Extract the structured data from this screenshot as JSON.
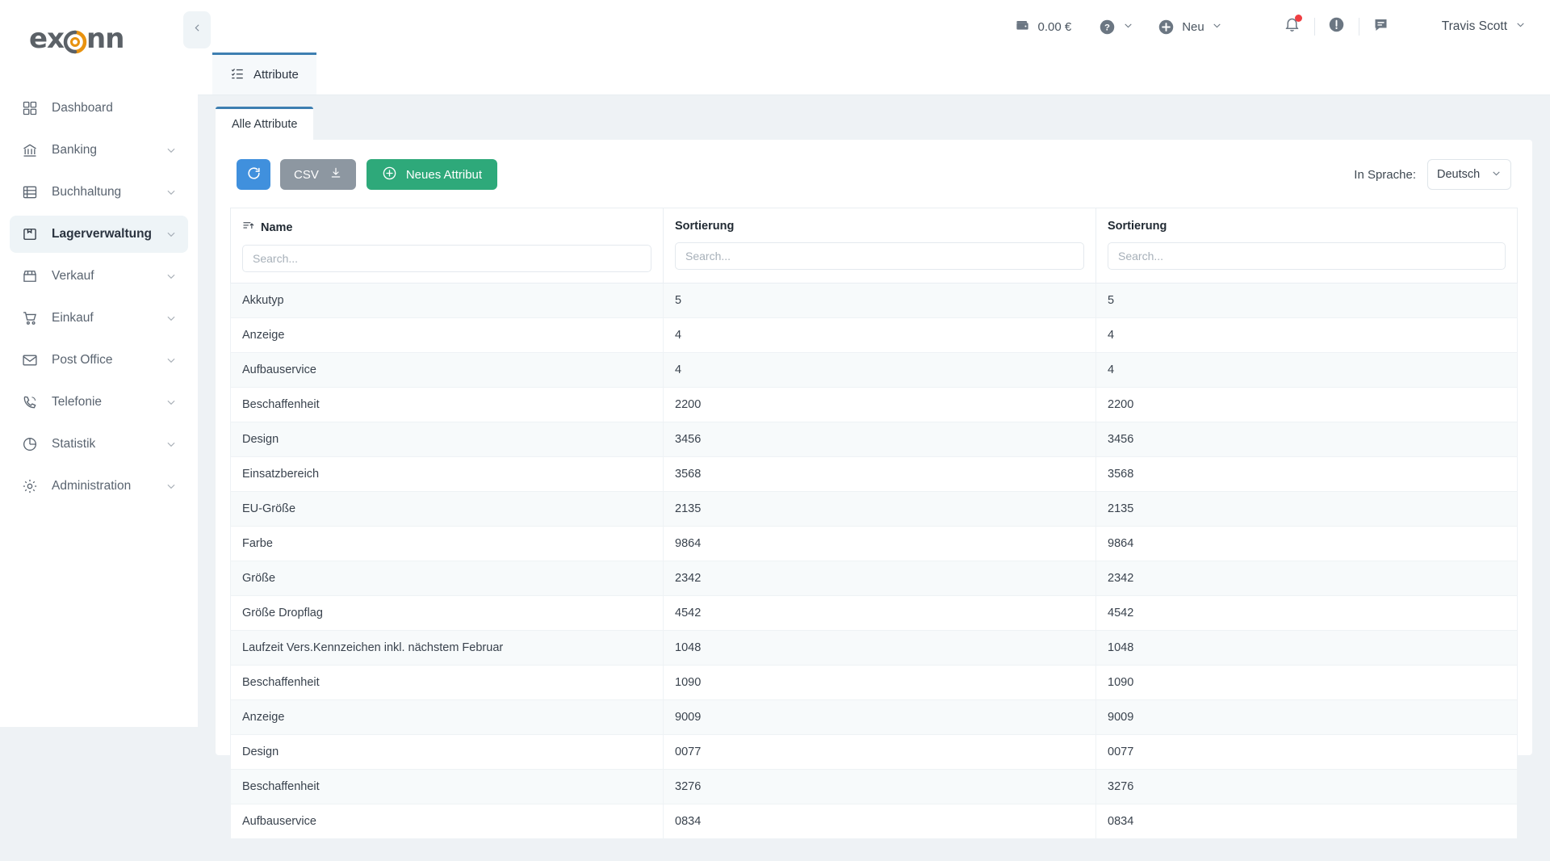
{
  "sidebar": {
    "logo_text_left": "ex",
    "logo_text_right": "nn",
    "collapse_icon": "chevron-left-icon",
    "items": [
      {
        "label": "Dashboard",
        "icon": "grid-icon",
        "has_chevron": false,
        "active": false
      },
      {
        "label": "Banking",
        "icon": "bank-icon",
        "has_chevron": true,
        "active": false
      },
      {
        "label": "Buchhaltung",
        "icon": "ledger-icon",
        "has_chevron": true,
        "active": false
      },
      {
        "label": "Lagerverwaltung",
        "icon": "box-icon",
        "has_chevron": true,
        "active": true
      },
      {
        "label": "Verkauf",
        "icon": "store-icon",
        "has_chevron": true,
        "active": false
      },
      {
        "label": "Einkauf",
        "icon": "cart-icon",
        "has_chevron": true,
        "active": false
      },
      {
        "label": "Post Office",
        "icon": "envelope-icon",
        "has_chevron": true,
        "active": false
      },
      {
        "label": "Telefonie",
        "icon": "phone-icon",
        "has_chevron": true,
        "active": false
      },
      {
        "label": "Statistik",
        "icon": "pie-chart-icon",
        "has_chevron": true,
        "active": false
      },
      {
        "label": "Administration",
        "icon": "gear-icon",
        "has_chevron": true,
        "active": false
      }
    ]
  },
  "topbar": {
    "wallet_amount": "0.00 €",
    "wallet_icon": "wallet-icon",
    "help_icon": "help-circle-icon",
    "new_label": "Neu",
    "new_icon": "plus-circle-icon",
    "notification_icon": "bell-icon",
    "alert_icon": "exclamation-circle-icon",
    "messages_icon": "message-icon",
    "user_name": "Travis Scott",
    "notification_badge_color": "#ef3e42"
  },
  "tabs": {
    "main_tab": {
      "label": "Attribute",
      "icon": "checklist-icon"
    },
    "sub_tab": {
      "label": "Alle Attribute"
    },
    "accent_color": "#3e7fb1"
  },
  "toolbar": {
    "refresh_icon": "refresh-icon",
    "refresh_color": "#4090dd",
    "csv_label": "CSV",
    "csv_icon": "download-icon",
    "csv_color": "#8d97a1",
    "new_attribute_label": "Neues Attribut",
    "new_attribute_icon": "plus-circle-icon",
    "new_attribute_color": "#2ea97a",
    "language_label": "In Sprache:",
    "language_value": "Deutsch",
    "language_chevron": "chevron-down-icon"
  },
  "table": {
    "columns": [
      {
        "label": "Name",
        "sort_icon": "sort-ascending-icon",
        "search_placeholder": "Search..."
      },
      {
        "label": "Sortierung",
        "sort_icon": null,
        "search_placeholder": "Search..."
      },
      {
        "label": "Sortierung",
        "sort_icon": null,
        "search_placeholder": "Search..."
      }
    ],
    "rows": [
      {
        "name": "Akkutyp",
        "sort1": "5",
        "sort2": "5"
      },
      {
        "name": "Anzeige",
        "sort1": "4",
        "sort2": "4"
      },
      {
        "name": "Aufbauservice",
        "sort1": "4",
        "sort2": "4"
      },
      {
        "name": "Beschaffenheit",
        "sort1": "2200",
        "sort2": "2200"
      },
      {
        "name": "Design",
        "sort1": "3456",
        "sort2": "3456"
      },
      {
        "name": "Einsatzbereich",
        "sort1": "3568",
        "sort2": "3568"
      },
      {
        "name": "EU-Größe",
        "sort1": "2135",
        "sort2": "2135"
      },
      {
        "name": "Farbe",
        "sort1": "9864",
        "sort2": "9864"
      },
      {
        "name": "Größe",
        "sort1": "2342",
        "sort2": "2342"
      },
      {
        "name": "Größe Dropflag",
        "sort1": "4542",
        "sort2": "4542"
      },
      {
        "name": "Laufzeit Vers.Kennzeichen inkl. nächstem Februar",
        "sort1": "1048",
        "sort2": "1048"
      },
      {
        "name": "Beschaffenheit",
        "sort1": "1090",
        "sort2": "1090"
      },
      {
        "name": "Anzeige",
        "sort1": "9009",
        "sort2": "9009"
      },
      {
        "name": "Design",
        "sort1": "0077",
        "sort2": "0077"
      },
      {
        "name": "Beschaffenheit",
        "sort1": "3276",
        "sort2": "3276"
      },
      {
        "name": "Aufbauservice",
        "sort1": "0834",
        "sort2": "0834"
      }
    ]
  }
}
